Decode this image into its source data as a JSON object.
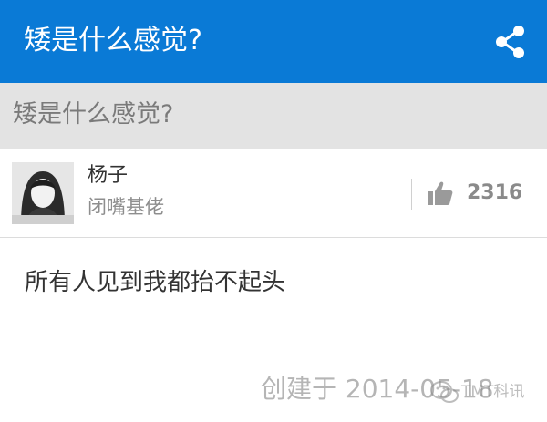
{
  "header": {
    "title": "矮是什么感觉?",
    "share_icon": "share-icon"
  },
  "question": {
    "title": "矮是什么感觉?"
  },
  "author": {
    "name": "杨子",
    "bio": "闭嘴基佬",
    "likes": "2316",
    "like_icon": "thumbs-up-icon"
  },
  "answer": {
    "text": "所有人见到我都抬不起头",
    "created": "创建于 2014-05-18"
  },
  "watermark": {
    "text": "TMT科讯"
  },
  "colors": {
    "header_bg": "#0a7ad6",
    "question_bar_bg": "#e3e3e3"
  }
}
